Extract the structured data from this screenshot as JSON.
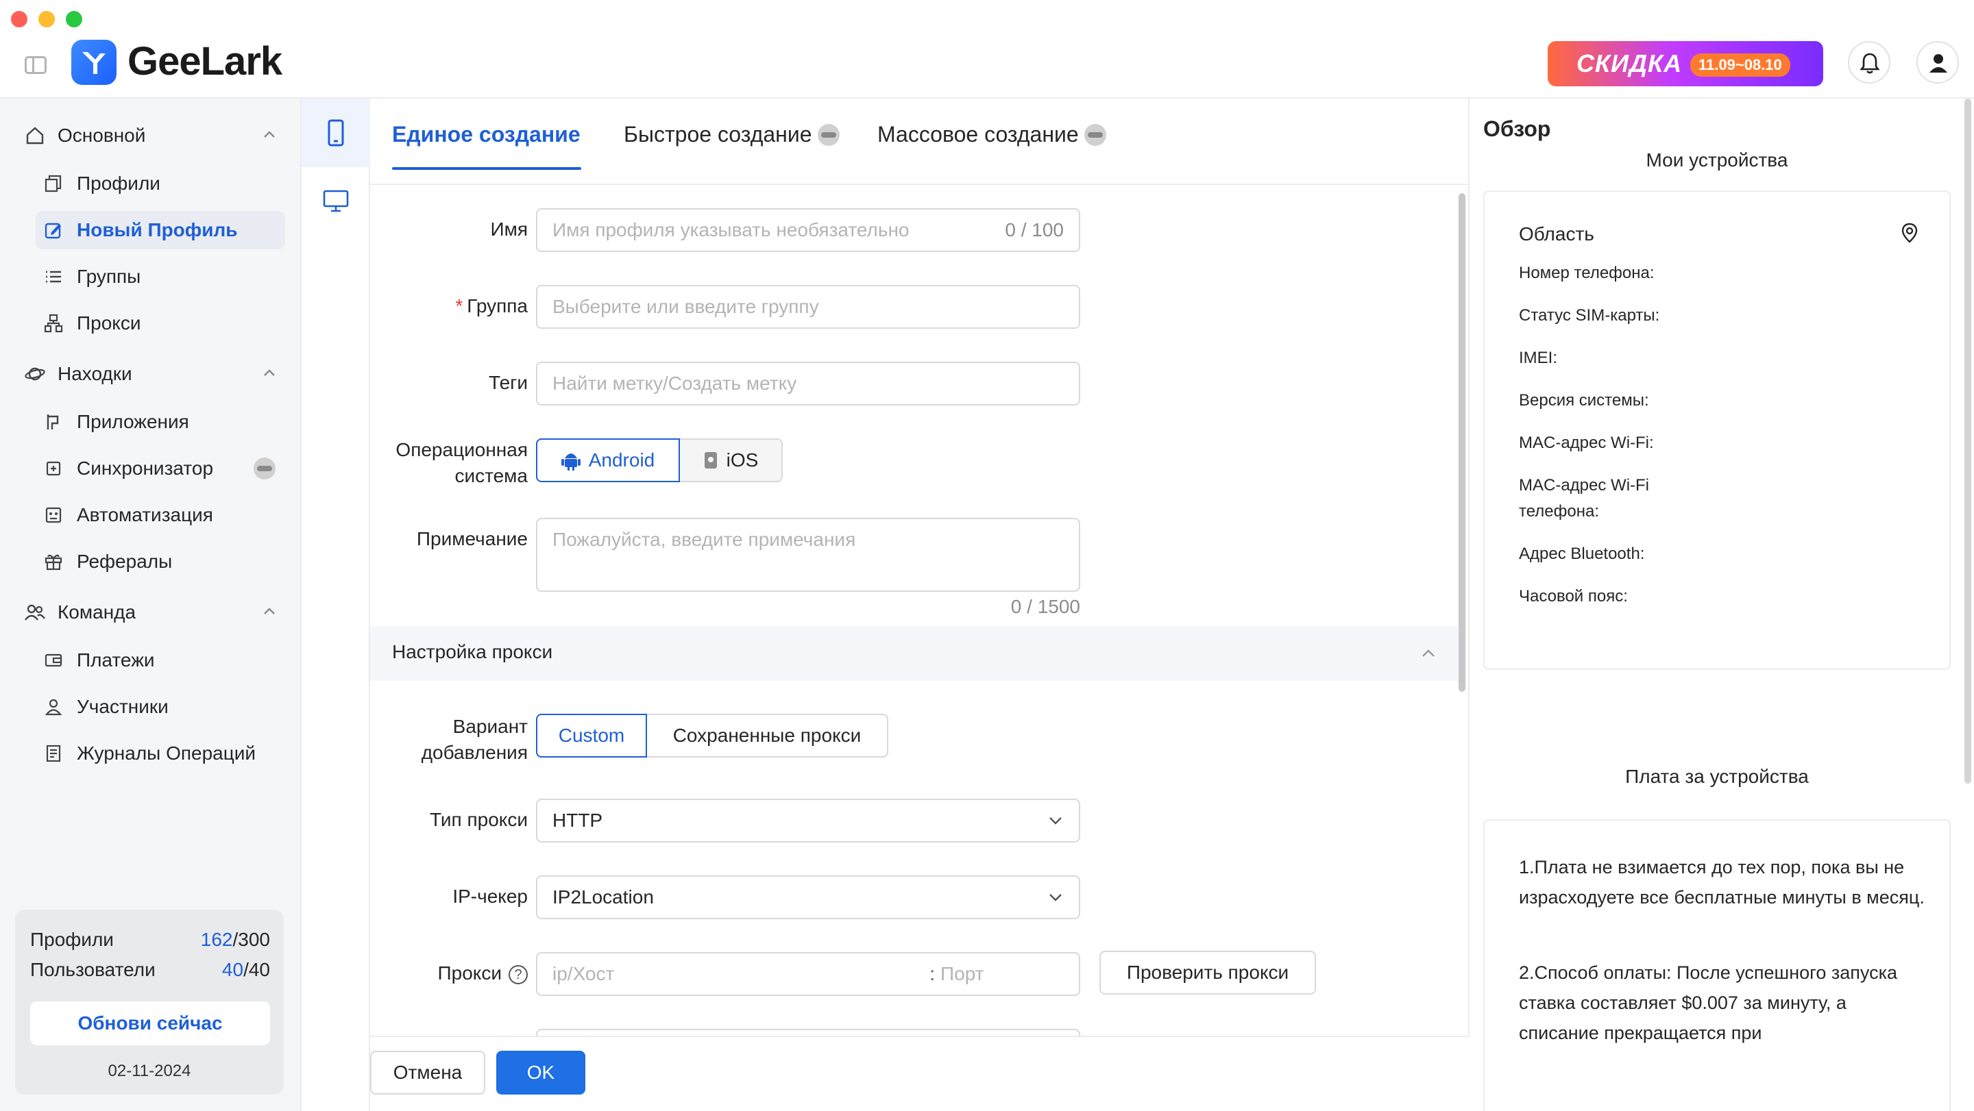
{
  "app": {
    "name": "GeeLark"
  },
  "promo": {
    "label": "СКИДКА",
    "dates": "11.09~08.10"
  },
  "sidebar": {
    "groups": {
      "main": "Основной",
      "finds": "Находки",
      "team": "Команда"
    },
    "items": {
      "profiles": "Профили",
      "new_profile": "Новый Профиль",
      "groups": "Группы",
      "proxy": "Прокси",
      "apps": "Приложения",
      "sync": "Синхронизатор",
      "automation": "Автоматизация",
      "referrals": "Рефералы",
      "payments": "Платежи",
      "members": "Участники",
      "logs": "Журналы Операций"
    },
    "plan": {
      "profiles_label": "Профили",
      "profiles_used": "162",
      "profiles_total": "/300",
      "users_label": "Пользователи",
      "users_used": "40",
      "users_total": "/40",
      "upgrade": "Обнови сейчас",
      "date": "02-11-2024"
    }
  },
  "tabs": {
    "single": "Единое создание",
    "quick": "Быстрое создание",
    "bulk": "Массовое создание"
  },
  "form": {
    "name_label": "Имя",
    "name_placeholder": "Имя профиля указывать необязательно",
    "name_count": "0 / 100",
    "group_label": "Группа",
    "group_placeholder": "Выберите или введите группу",
    "tags_label": "Теги",
    "tags_placeholder": "Найти метку/Создать метку",
    "os_label": "Операционная система",
    "os_android": "Android",
    "os_ios": "iOS",
    "note_label": "Примечание",
    "note_placeholder": "Пожалуйста, введите примечания",
    "note_count": "0 / 1500",
    "proxy_section": "Настройка прокси",
    "add_variant_label": "Вариант добавления",
    "add_custom": "Custom",
    "add_saved": "Сохраненные прокси",
    "proxy_type_label": "Тип прокси",
    "proxy_type_value": "HTTP",
    "ip_checker_label": "IP-чекер",
    "ip_checker_value": "IP2Location",
    "proxy_label": "Прокси",
    "host_placeholder": "ip/Хост",
    "port_placeholder": "Порт",
    "check_proxy": "Проверить прокси"
  },
  "footer": {
    "cancel": "Отмена",
    "ok": "OK"
  },
  "overview": {
    "title": "Обзор",
    "my_devices": "Мои устройства",
    "region": "Область",
    "fields": {
      "phone": "Номер телефона:",
      "sim": "Статус SIM-карты:",
      "imei": "IMEI:",
      "os_version": "Версия системы:",
      "wifi_mac": "MAC-адрес Wi-Fi:",
      "wifi_mac_phone": "MAC-адрес Wi-Fi телефона:",
      "bluetooth": "Адрес Bluetooth:",
      "timezone": "Часовой пояс:"
    },
    "fee_title": "Плата за устройства",
    "fee_p1": "1.Плата не взимается до тех пор, пока вы не израсходуете все бесплатные минуты в месяц.",
    "fee_p2": "2.Способ оплаты: После успешного запуска ставка составляет $0.007 за минуту, а списание прекращается при"
  },
  "colors": {
    "accent": "#1f5fd6",
    "ok_button": "#1f6fe5",
    "required": "#e53935"
  }
}
